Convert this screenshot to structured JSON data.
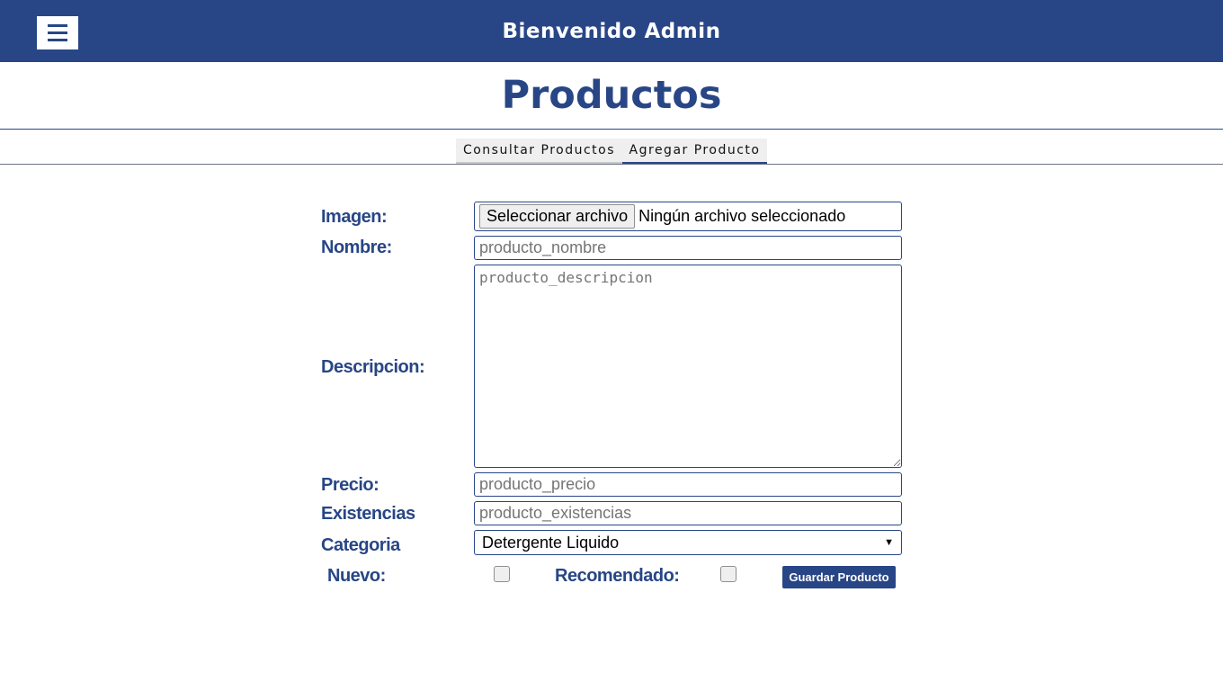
{
  "header": {
    "welcome_text": "Bienvenido Admin",
    "menu_icon": "hamburger-menu-icon"
  },
  "page": {
    "title": "Productos"
  },
  "tabs": [
    {
      "label": "Consultar Productos",
      "active": false
    },
    {
      "label": "Agregar Producto",
      "active": true
    }
  ],
  "form": {
    "imagen": {
      "label": "Imagen:",
      "button_label": "Seleccionar archivo",
      "status_text": "Ningún archivo seleccionado"
    },
    "nombre": {
      "label": "Nombre:",
      "placeholder": "producto_nombre",
      "value": ""
    },
    "descripcion": {
      "label": "Descripcion:",
      "placeholder": "producto_descripcion",
      "value": ""
    },
    "precio": {
      "label": "Precio:",
      "placeholder": "producto_precio",
      "value": ""
    },
    "existencias": {
      "label": "Existencias",
      "placeholder": "producto_existencias",
      "value": ""
    },
    "categoria": {
      "label": "Categoria",
      "selected": "Detergente Liquido"
    },
    "nuevo": {
      "label": "Nuevo:",
      "checked": false
    },
    "recomendado": {
      "label": "Recomendado:",
      "checked": false
    },
    "save_label": "Guardar Producto"
  },
  "colors": {
    "brand": "#284686",
    "tab_background": "#efefef",
    "page_background": "#ffffff"
  }
}
